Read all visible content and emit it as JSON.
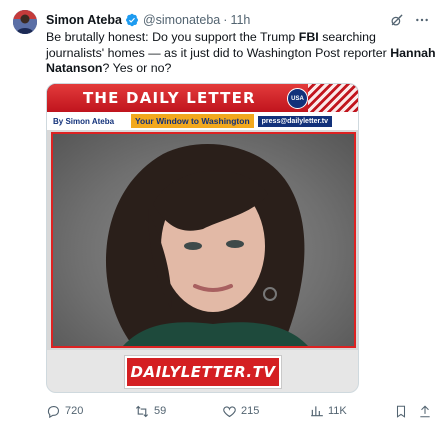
{
  "author": {
    "name": "Simon Ateba",
    "handle": "@simonateba",
    "separator": "·",
    "time": "11h"
  },
  "tweet": {
    "text_part1": "Be brutally honest: Do you support the Trump ",
    "bold1": "FBI",
    "text_part2": " searching journalists' homes — as it just did to Washington Post reporter ",
    "bold2": "Hannah Natanson",
    "text_part3": "? Yes or no?"
  },
  "media": {
    "banner_title": "THE  DAILY  LETTER",
    "banner_badge": "USA",
    "byline": "By Simon Ateba",
    "tagline": "Your Window to Washington",
    "email": "press@dailyletter.tv",
    "footer_logo": "DAILYLETTER.TV"
  },
  "actions": {
    "replies": "720",
    "reposts": "59",
    "likes": "215",
    "views": "11K"
  },
  "icons": {
    "verified": "verified-badge-icon",
    "grok": "grok-icon",
    "more": "more-icon",
    "reply": "reply-icon",
    "retweet": "retweet-icon",
    "like": "heart-icon",
    "views": "views-icon",
    "bookmark": "bookmark-icon",
    "share": "share-icon"
  },
  "colors": {
    "verified_blue": "#1d9bf0",
    "text_primary": "#0f1419",
    "text_secondary": "#536471",
    "banner_red": "#c0141d",
    "banner_navy": "#12317a",
    "tagline_orange": "#f2a81d"
  }
}
